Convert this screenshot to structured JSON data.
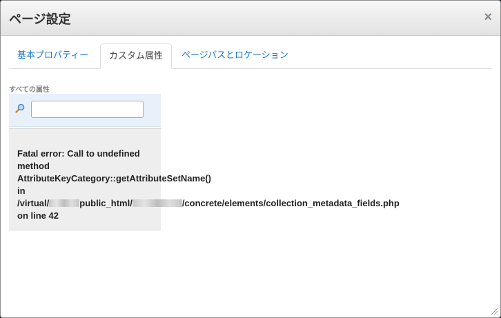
{
  "dialog": {
    "title": "ページ設定",
    "close_label": "×"
  },
  "tabs": [
    {
      "label": "基本プロパティー",
      "active": false
    },
    {
      "label": "カスタム属性",
      "active": true
    },
    {
      "label": "ページパスとロケーション",
      "active": false
    }
  ],
  "attributes": {
    "section_label": "すべての属性",
    "search_value": "",
    "search_placeholder": ""
  },
  "error": {
    "line1": "Fatal error: Call to undefined",
    "line2": "method",
    "line3": "AttributeKeyCategory::getAttributeSetName()",
    "line4": "in",
    "path_prefix": "/virtual/",
    "path_middle": "public_html/",
    "path_suffix": "/concrete/elements/collection_metadata_fields.php",
    "line6": "on line 42"
  },
  "colors": {
    "link": "#1a77c9",
    "search_bg": "#e8f1f9",
    "panel_bg": "#eeeeee"
  }
}
